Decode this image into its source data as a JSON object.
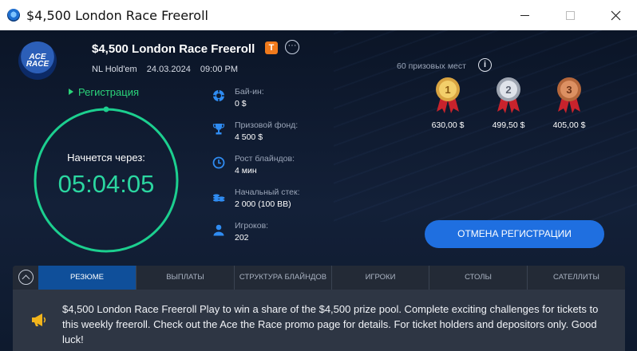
{
  "window": {
    "title": "$4,500 London Race Freeroll"
  },
  "header": {
    "logo_text_line1": "ACE",
    "logo_text_line2": "RACE",
    "tournament_title": "$4,500 London Race Freeroll",
    "badge": "T",
    "more": "···",
    "game": "NL Hold'em",
    "date": "24.03.2024",
    "time": "09:00 PM"
  },
  "registration": {
    "status": "Регистрация",
    "starts_label": "Начнется через:",
    "countdown": "05:04:05"
  },
  "info": [
    {
      "icon": "chip-icon",
      "label": "Бай-ин:",
      "value": "0 $"
    },
    {
      "icon": "trophy-icon",
      "label": "Призовой фонд:",
      "value": "4 500 $"
    },
    {
      "icon": "clock-icon",
      "label": "Рост блайндов:",
      "value": "4 мин"
    },
    {
      "icon": "chip-stack-icon",
      "label": "Начальный стек:",
      "value": "2 000 (100 BB)"
    },
    {
      "icon": "user-icon",
      "label": "Игроков:",
      "value": "202"
    }
  ],
  "prizes": {
    "places_label": "60 призовых мест",
    "info_symbol": "i",
    "medals": [
      {
        "rank": "1",
        "value": "630,00 $",
        "color": "#d9a441"
      },
      {
        "rank": "2",
        "value": "499,50 $",
        "color": "#b9bfc9"
      },
      {
        "rank": "3",
        "value": "405,00 $",
        "color": "#c4774a"
      }
    ]
  },
  "actions": {
    "cancel_registration": "ОТМЕНА РЕГИСТРАЦИИ"
  },
  "tabs": [
    "РЕЗЮМЕ",
    "ВЫПЛАТЫ",
    "СТРУКТУРА БЛАЙНДОВ",
    "ИГРОКИ",
    "СТОЛЫ",
    "САТЕЛЛИТЫ"
  ],
  "summary": {
    "text": "$4,500 London Race Freeroll Play to win a share of the $4,500 prize pool. Complete exciting challenges for tickets to this weekly freeroll. Check out the Ace the Race promo page for details. For ticket holders and depositors only. Good luck!"
  },
  "colors": {
    "accent_green": "#2bd47a",
    "accent_blue": "#1f6fe0",
    "badge_orange": "#f07a1c"
  }
}
